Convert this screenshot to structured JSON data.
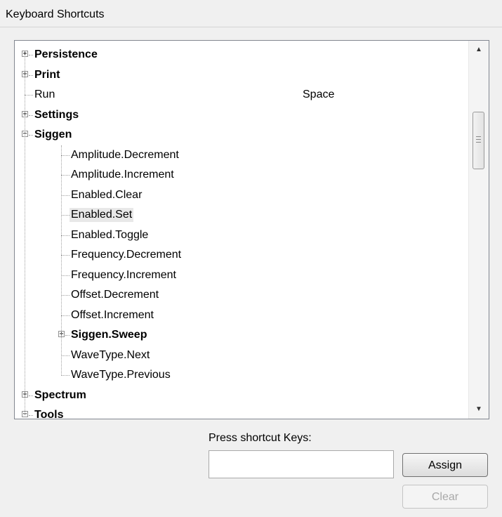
{
  "header": {
    "title": "Keyboard Shortcuts"
  },
  "tree": {
    "rows": [
      {
        "label": "Persistence",
        "key": "",
        "depth": 0,
        "bold": true,
        "expander": "+"
      },
      {
        "label": "Print",
        "key": "",
        "depth": 0,
        "bold": true,
        "expander": "+"
      },
      {
        "label": "Run",
        "key": "Space",
        "depth": 0,
        "bold": false,
        "expander": ""
      },
      {
        "label": "Settings",
        "key": "",
        "depth": 0,
        "bold": true,
        "expander": "+"
      },
      {
        "label": "Siggen",
        "key": "",
        "depth": 0,
        "bold": true,
        "expander": "−"
      },
      {
        "label": "Amplitude.Decrement",
        "key": "",
        "depth": 1,
        "bold": false,
        "expander": ""
      },
      {
        "label": "Amplitude.Increment",
        "key": "",
        "depth": 1,
        "bold": false,
        "expander": ""
      },
      {
        "label": "Enabled.Clear",
        "key": "",
        "depth": 1,
        "bold": false,
        "expander": ""
      },
      {
        "label": "Enabled.Set",
        "key": "",
        "depth": 1,
        "bold": false,
        "expander": "",
        "selected": true
      },
      {
        "label": "Enabled.Toggle",
        "key": "",
        "depth": 1,
        "bold": false,
        "expander": ""
      },
      {
        "label": "Frequency.Decrement",
        "key": "",
        "depth": 1,
        "bold": false,
        "expander": ""
      },
      {
        "label": "Frequency.Increment",
        "key": "",
        "depth": 1,
        "bold": false,
        "expander": ""
      },
      {
        "label": "Offset.Decrement",
        "key": "",
        "depth": 1,
        "bold": false,
        "expander": ""
      },
      {
        "label": "Offset.Increment",
        "key": "",
        "depth": 1,
        "bold": false,
        "expander": ""
      },
      {
        "label": "Siggen.Sweep",
        "key": "",
        "depth": 1,
        "bold": true,
        "expander": "+"
      },
      {
        "label": "WaveType.Next",
        "key": "",
        "depth": 1,
        "bold": false,
        "expander": ""
      },
      {
        "label": "WaveType.Previous",
        "key": "",
        "depth": 1,
        "bold": false,
        "expander": ""
      },
      {
        "label": "Spectrum",
        "key": "",
        "depth": 0,
        "bold": true,
        "expander": "+"
      },
      {
        "label": "Tools",
        "key": "",
        "depth": 0,
        "bold": true,
        "expander": "−"
      }
    ]
  },
  "scrollbar": {
    "up_icon": "▲",
    "down_icon": "▼"
  },
  "shortcut": {
    "label": "Press shortcut Keys:",
    "value": "",
    "assign_label": "Assign",
    "clear_label": "Clear"
  }
}
